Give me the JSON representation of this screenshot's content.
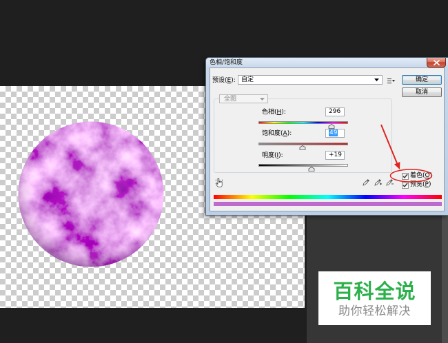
{
  "dialog": {
    "title": "色相/饱和度",
    "preset": {
      "label": "预设(E):",
      "value": "自定"
    },
    "buttons": {
      "ok": "确定",
      "cancel": "取消"
    },
    "channel": {
      "value": "全图"
    },
    "hue": {
      "label": "色相(H):",
      "value": "296"
    },
    "saturation": {
      "label": "饱和度(A):",
      "value": "49"
    },
    "lightness": {
      "label": "明度(I):",
      "value": "+19"
    },
    "colorize": {
      "label": "着色(O)",
      "checked": true
    },
    "preview": {
      "label": "预览(P)",
      "checked": true
    },
    "result_color": "#bd6bcc"
  },
  "icons": {
    "close": "close-icon",
    "preset_menu": "preset-options-icon",
    "dropdown": "chevron-down-icon",
    "targeted_adjustment": "hand-adjust-icon",
    "eyedropper": "eyedropper-icon",
    "eyedropper_add": "eyedropper-plus-icon",
    "eyedropper_subtract": "eyedropper-minus-icon"
  },
  "annotation": {
    "color": "#e0231f"
  },
  "watermark": {
    "title": "百科全说",
    "subtitle": "助你轻松解决",
    "title_color": "#2db04b"
  }
}
